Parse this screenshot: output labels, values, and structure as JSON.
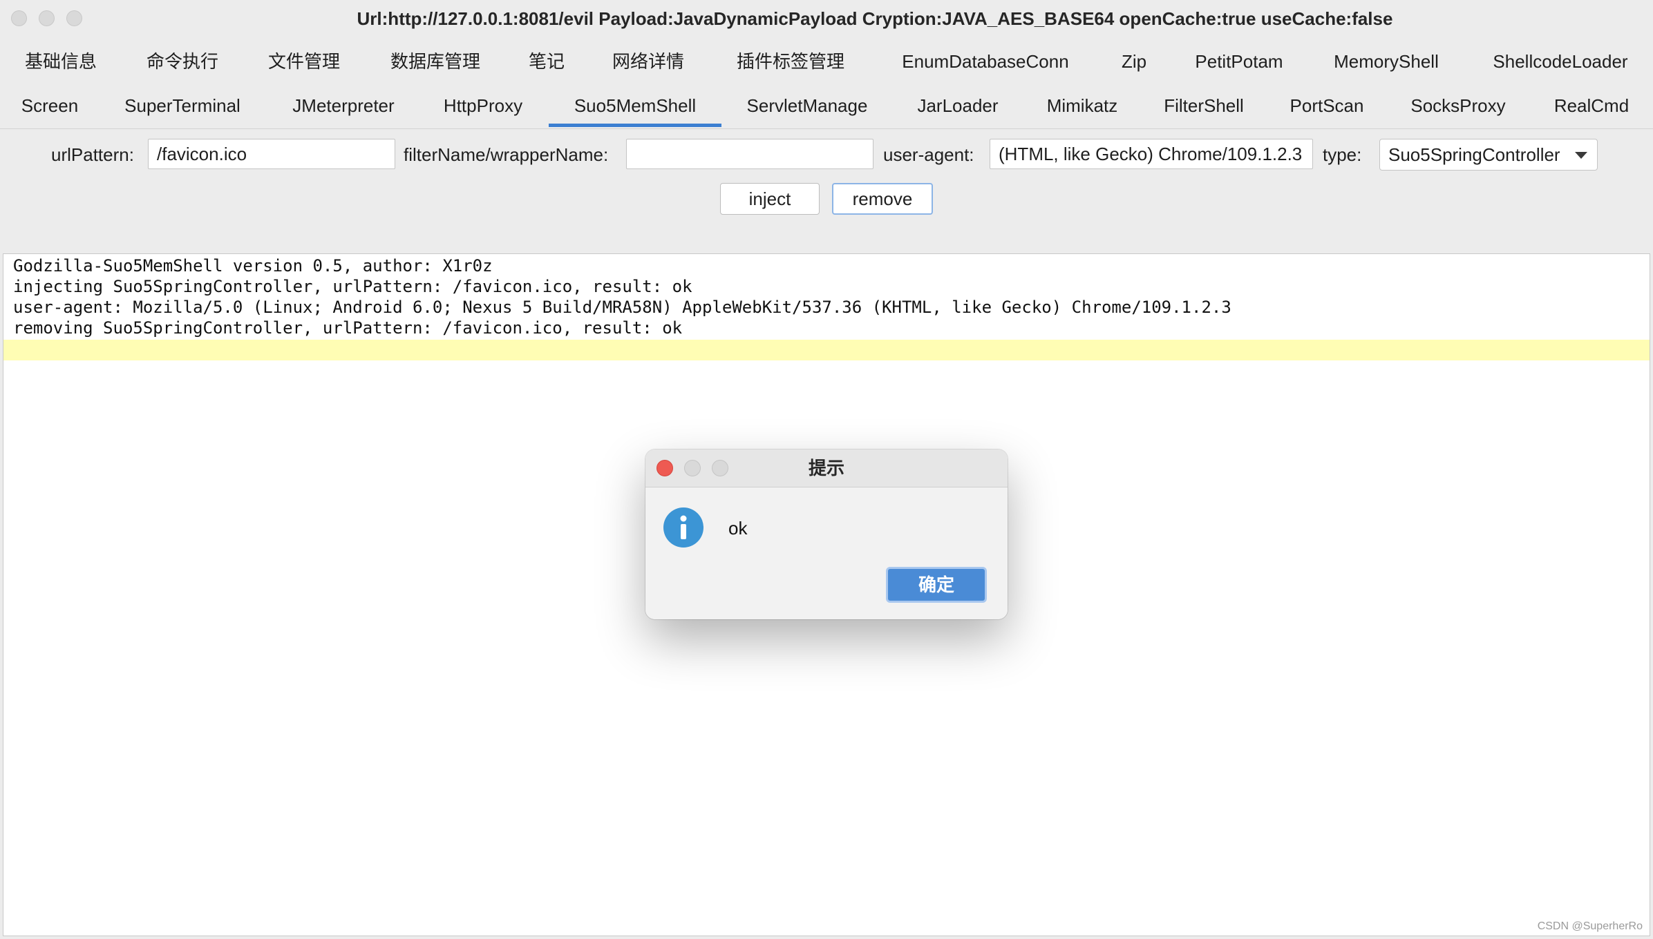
{
  "window": {
    "title": "Url:http://127.0.0.1:8081/evil Payload:JavaDynamicPayload Cryption:JAVA_AES_BASE64 openCache:true useCache:false"
  },
  "tabs_row1": [
    {
      "label": "基础信息"
    },
    {
      "label": "命令执行"
    },
    {
      "label": "文件管理"
    },
    {
      "label": "数据库管理"
    },
    {
      "label": "笔记"
    },
    {
      "label": "网络详情"
    },
    {
      "label": "插件标签管理"
    },
    {
      "label": "EnumDatabaseConn"
    },
    {
      "label": "Zip"
    },
    {
      "label": "PetitPotam"
    },
    {
      "label": "MemoryShell"
    },
    {
      "label": "ShellcodeLoader"
    }
  ],
  "tabs_row2": [
    {
      "label": "Screen"
    },
    {
      "label": "SuperTerminal"
    },
    {
      "label": "JMeterpreter"
    },
    {
      "label": "HttpProxy"
    },
    {
      "label": "Suo5MemShell",
      "selected": true
    },
    {
      "label": "ServletManage"
    },
    {
      "label": "JarLoader"
    },
    {
      "label": "Mimikatz"
    },
    {
      "label": "FilterShell"
    },
    {
      "label": "PortScan"
    },
    {
      "label": "SocksProxy"
    },
    {
      "label": "RealCmd"
    }
  ],
  "form": {
    "url_pattern_label": "urlPattern:",
    "url_pattern_value": "/favicon.ico",
    "filter_name_label": "filterName/wrapperName:",
    "filter_name_value": "",
    "user_agent_label": "user-agent:",
    "user_agent_value": "(HTML, like Gecko) Chrome/109.1.2.3",
    "type_label": "type:",
    "type_value": "Suo5SpringController",
    "inject_label": "inject",
    "remove_label": "remove"
  },
  "console": {
    "lines": [
      "Godzilla-Suo5MemShell version 0.5, author: X1r0z",
      "injecting Suo5SpringController, urlPattern: /favicon.ico, result: ok",
      "user-agent: Mozilla/5.0 (Linux; Android 6.0; Nexus 5 Build/MRA58N) AppleWebKit/537.36 (KHTML, like Gecko) Chrome/109.1.2.3",
      "removing Suo5SpringController, urlPattern: /favicon.ico, result: ok"
    ]
  },
  "dialog": {
    "title": "提示",
    "message": "ok",
    "ok_label": "确定",
    "icon": "info-icon"
  },
  "watermark": "CSDN @SuperherRo",
  "colors": {
    "accent": "#3c7fd1",
    "current_line": "#fffdb4",
    "info_icon": "#3c95d5",
    "close_dot": "#ee5a52"
  }
}
